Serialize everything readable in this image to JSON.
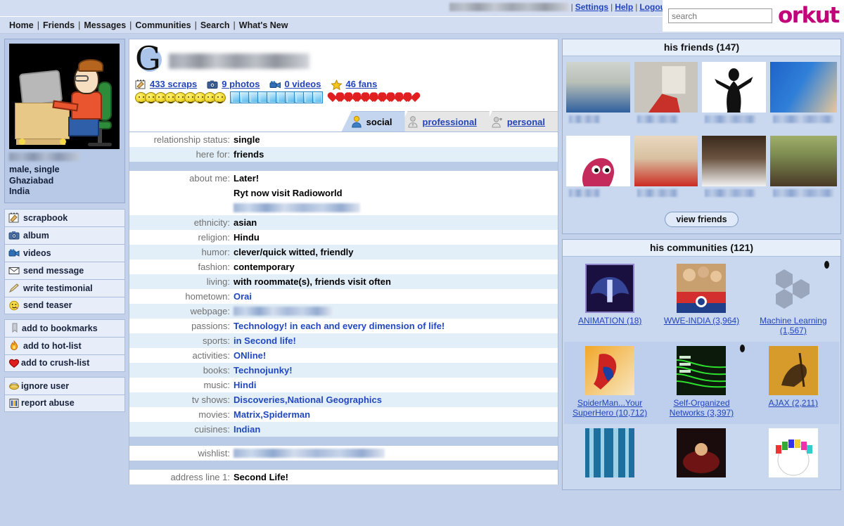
{
  "topbar": {
    "user_email_redacted": true,
    "links": [
      {
        "label": "Settings",
        "name": "settings-link"
      },
      {
        "label": "Help",
        "name": "help-link"
      },
      {
        "label": "Logout",
        "name": "logout-link"
      }
    ],
    "separator": "|",
    "search": {
      "placeholder": "search",
      "value": ""
    },
    "brand": "orkut"
  },
  "nav": {
    "items": [
      "Home",
      "Friends",
      "Messages",
      "Communities",
      "Search",
      "What's New"
    ],
    "separator": "|"
  },
  "profile_card": {
    "photo_alt": "cartoon of man at computer desk",
    "name_redacted": true,
    "meta_lines": [
      "male, single",
      "Ghaziabad",
      "India"
    ]
  },
  "actions": {
    "groups": [
      [
        {
          "label": "scrapbook",
          "icon": "scrapbook-icon"
        },
        {
          "label": "album",
          "icon": "camera-icon"
        },
        {
          "label": "videos",
          "icon": "video-camera-icon"
        },
        {
          "label": "send message",
          "icon": "envelope-icon"
        },
        {
          "label": "write testimonial",
          "icon": "pen-icon"
        },
        {
          "label": "send teaser",
          "icon": "wink-smiley-icon"
        }
      ],
      [
        {
          "label": "add to bookmarks",
          "icon": "bookmark-icon"
        },
        {
          "label": "add to hot-list",
          "icon": "flame-icon"
        },
        {
          "label": "add to crush-list",
          "icon": "heart-icon"
        }
      ],
      [
        {
          "label": "ignore user",
          "icon": "ignore-icon"
        },
        {
          "label": "report abuse",
          "icon": "report-icon"
        }
      ]
    ]
  },
  "profile_header": {
    "avatar_letter": "G",
    "name_redacted": true,
    "stats": [
      {
        "count": "433",
        "label": "scraps",
        "icon": "scrapbook-icon"
      },
      {
        "count": "9",
        "label": "photos",
        "icon": "camera-icon"
      },
      {
        "count": "0",
        "label": "videos",
        "icon": "video-camera-icon"
      },
      {
        "count": "46",
        "label": "fans",
        "icon": "star-icon"
      }
    ],
    "ratings": {
      "cool": 9,
      "trustworthy": 10,
      "sexy": 10
    },
    "tabs": [
      {
        "label": "social",
        "active": true,
        "icon": "person-icon"
      },
      {
        "label": "professional",
        "active": false,
        "icon": "person-tie-icon"
      },
      {
        "label": "personal",
        "active": false,
        "icon": "person-heart-icon"
      }
    ]
  },
  "info": {
    "rows": [
      {
        "label": "relationship status:",
        "value": "single",
        "style": "bold"
      },
      {
        "label": "here for:",
        "value": "friends",
        "style": "bold"
      },
      {
        "type": "spacer"
      },
      {
        "label": "about me:",
        "value": "Later!\nRyt now visit Radioworld",
        "style": "bold",
        "redacted_extra": true
      },
      {
        "label": "ethnicity:",
        "value": "asian",
        "style": "bold"
      },
      {
        "label": "religion:",
        "value": "Hindu",
        "style": "bold"
      },
      {
        "label": "humor:",
        "value": "clever/quick witted, friendly",
        "style": "bold"
      },
      {
        "label": "fashion:",
        "value": "contemporary",
        "style": "bold"
      },
      {
        "label": "living:",
        "value": "with roommate(s), friends visit often",
        "style": "bold"
      },
      {
        "label": "hometown:",
        "value": "Orai",
        "style": "link"
      },
      {
        "label": "webpage:",
        "value": "",
        "style": "link",
        "redacted": true
      },
      {
        "label": "passions:",
        "value": "Technology! in each and every dimension of life!",
        "style": "link"
      },
      {
        "label": "sports:",
        "value": "in Second life!",
        "style": "link"
      },
      {
        "label": "activities:",
        "value": "ONline!",
        "style": "link"
      },
      {
        "label": "books:",
        "value": "Technojunky!",
        "style": "link"
      },
      {
        "label": "music:",
        "value": "Hindi",
        "style": "link"
      },
      {
        "label": "tv shows:",
        "value": "Discoveries,National Geographics",
        "style": "link"
      },
      {
        "label": "movies:",
        "value": "Matrix,Spiderman",
        "style": "link"
      },
      {
        "label": "cuisines:",
        "value": "Indian",
        "style": "link"
      },
      {
        "type": "spacer"
      },
      {
        "label": "wishlist:",
        "value": "",
        "style": "bold",
        "redacted": true
      },
      {
        "type": "spacer"
      },
      {
        "label": "address line 1:",
        "value": "Second Life!",
        "style": "bold"
      }
    ]
  },
  "friends_panel": {
    "title": "his friends",
    "count": "(147)",
    "button": "view friends",
    "items": [
      {
        "art": "man-blue-shirt",
        "name_redacted": true
      },
      {
        "art": "red-motorbike",
        "name_redacted": true
      },
      {
        "art": "black-silhouette-dancer",
        "name_redacted": true
      },
      {
        "art": "man-blue-closeup",
        "name_redacted": true
      },
      {
        "art": "red-cartoon-creature",
        "name_redacted": true
      },
      {
        "art": "man-red-shirt",
        "name_redacted": true
      },
      {
        "art": "man-white-shirt",
        "name_redacted": true
      },
      {
        "art": "man-sunglasses-field",
        "name_redacted": true
      }
    ]
  },
  "communities_panel": {
    "title": "his communities",
    "count": "(121)",
    "items": [
      {
        "label": "ANIMATION (18)",
        "art": "dark-blue-wings"
      },
      {
        "label": "WWE-INDIA (3,964)",
        "art": "wrestlers"
      },
      {
        "label": "Machine Learning (1,567)",
        "art": "gray-hexagons"
      },
      {
        "label": "SpiderMan...Your SuperHero (10,712)",
        "art": "spiderman"
      },
      {
        "label": "Self-Organized Networks (3,397)",
        "art": "green-network"
      },
      {
        "label": "AJAX (2,211)",
        "art": "ajax-warrior"
      },
      {
        "label": "",
        "art": "blue-ice"
      },
      {
        "label": "",
        "art": "dark-stage"
      },
      {
        "label": "",
        "art": "colorful-flags"
      }
    ]
  },
  "colors": {
    "page_bg": "#c3d2ea",
    "topbar_bg": "#d3ddf1",
    "panel_bg": "#c9d8ef",
    "panel_head_bg": "#e6eefa",
    "link": "#2244bb",
    "brand": "#c3007a",
    "row_alt": "#e3eff8",
    "row_white": "#ffffff",
    "sidebar_card": "#b7c9e6"
  }
}
